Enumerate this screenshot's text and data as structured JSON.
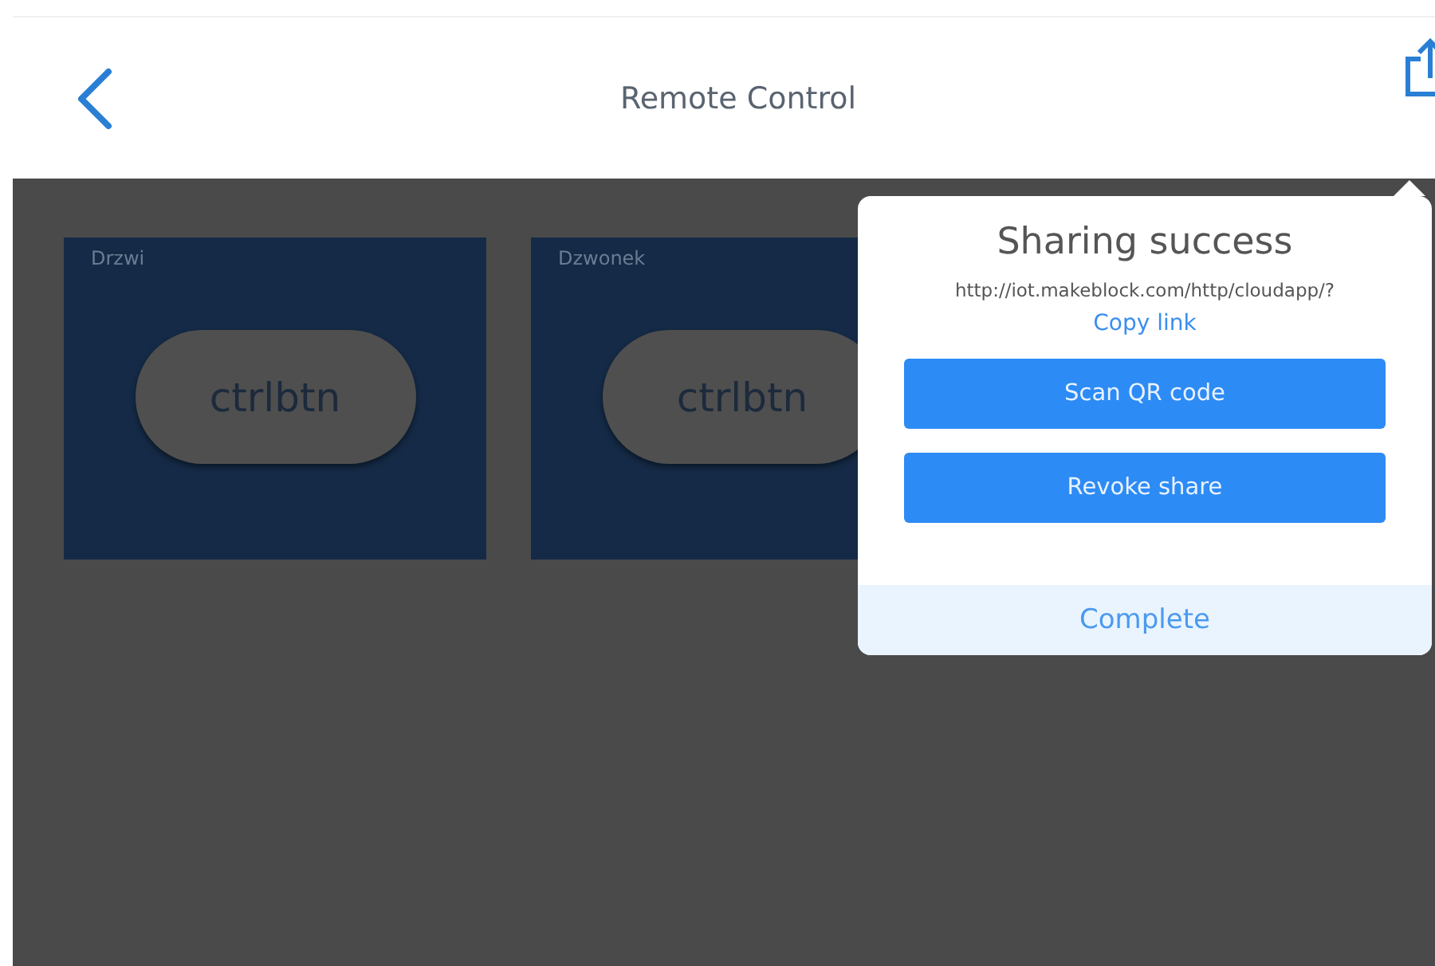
{
  "header": {
    "title": "Remote Control"
  },
  "cards": [
    {
      "label": "Drzwi",
      "button": "ctrlbtn"
    },
    {
      "label": "Dzwonek",
      "button": "ctrlbtn"
    }
  ],
  "popover": {
    "title": "Sharing success",
    "link": "http://iot.makeblock.com/http/cloudapp/?",
    "copy_link": "Copy link",
    "buttons": [
      "Scan QR code",
      "Revoke share"
    ],
    "complete": "Complete"
  }
}
